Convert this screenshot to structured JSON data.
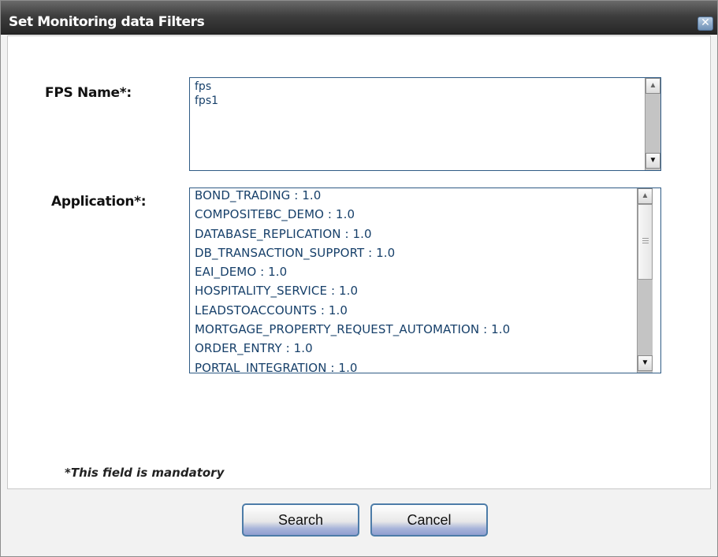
{
  "dialog": {
    "title": "Set Monitoring data Filters",
    "close_glyph": "✕"
  },
  "fps": {
    "label": "FPS Name*:",
    "items": [
      "fps",
      "fps1"
    ]
  },
  "application": {
    "label": "Application*:",
    "items": [
      "BOND_TRADING : 1.0",
      "COMPOSITEBC_DEMO : 1.0",
      "DATABASE_REPLICATION : 1.0",
      "DB_TRANSACTION_SUPPORT : 1.0",
      "EAI_DEMO : 1.0",
      "HOSPITALITY_SERVICE : 1.0",
      "LEADSTOACCOUNTS : 1.0",
      "MORTGAGE_PROPERTY_REQUEST_AUTOMATION : 1.0",
      "ORDER_ENTRY : 1.0",
      "PORTAL_INTEGRATION : 1.0"
    ]
  },
  "note": "*This field is mandatory",
  "buttons": {
    "search": "Search",
    "cancel": "Cancel"
  },
  "icons": {
    "scroll_up": "▲",
    "scroll_down": "▼"
  }
}
